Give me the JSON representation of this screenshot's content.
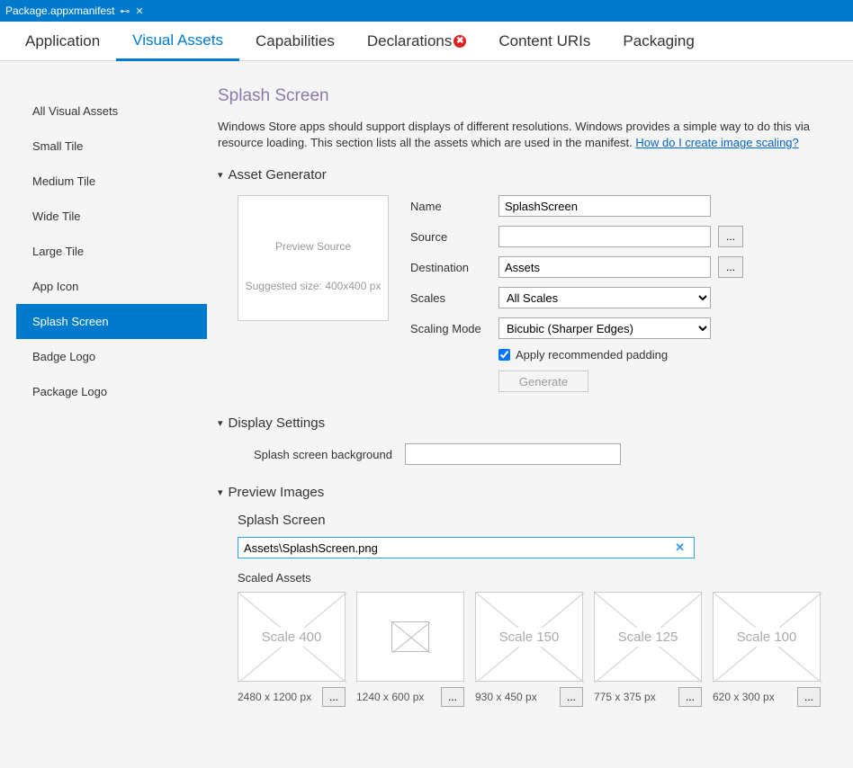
{
  "document_tab": {
    "title": "Package.appxmanifest"
  },
  "topnav": [
    {
      "label": "Application"
    },
    {
      "label": "Visual Assets"
    },
    {
      "label": "Capabilities"
    },
    {
      "label": "Declarations",
      "error": true
    },
    {
      "label": "Content URIs"
    },
    {
      "label": "Packaging"
    }
  ],
  "sidebar": {
    "items": [
      {
        "label": "All Visual Assets"
      },
      {
        "label": "Small Tile"
      },
      {
        "label": "Medium Tile"
      },
      {
        "label": "Wide Tile"
      },
      {
        "label": "Large Tile"
      },
      {
        "label": "App Icon"
      },
      {
        "label": "Splash Screen"
      },
      {
        "label": "Badge Logo"
      },
      {
        "label": "Package Logo"
      }
    ],
    "selected_index": 6
  },
  "main": {
    "heading": "Splash Screen",
    "intro_text": "Windows Store apps should support displays of different resolutions. Windows provides a simple way to do this via resource loading. This section lists all the assets which are used in the manifest. ",
    "intro_link": "How do I create image scaling?",
    "asset_generator": {
      "title": "Asset Generator",
      "preview_line1": "Preview Source",
      "preview_line2": "Suggested size: 400x400 px",
      "fields": {
        "name_label": "Name",
        "name_value": "SplashScreen",
        "source_label": "Source",
        "source_value": "",
        "destination_label": "Destination",
        "destination_value": "Assets",
        "scales_label": "Scales",
        "scales_value": "All Scales",
        "scaling_mode_label": "Scaling Mode",
        "scaling_mode_value": "Bicubic (Sharper Edges)",
        "apply_padding_label": "Apply recommended padding",
        "apply_padding_checked": true,
        "generate_label": "Generate",
        "browse_label": "..."
      }
    },
    "display_settings": {
      "title": "Display Settings",
      "bg_label": "Splash screen background",
      "bg_value": ""
    },
    "preview_images": {
      "title": "Preview Images",
      "subtitle": "Splash Screen",
      "path_value": "Assets\\SplashScreen.png",
      "scaled_label": "Scaled Assets",
      "thumbs": [
        {
          "label": "Scale 400",
          "size": "2480 x 1200 px"
        },
        {
          "label": "",
          "size": "1240 x 600 px",
          "mini": true
        },
        {
          "label": "Scale 150",
          "size": "930 x 450 px"
        },
        {
          "label": "Scale 125",
          "size": "775 x 375 px"
        },
        {
          "label": "Scale 100",
          "size": "620 x 300 px"
        }
      ]
    }
  }
}
